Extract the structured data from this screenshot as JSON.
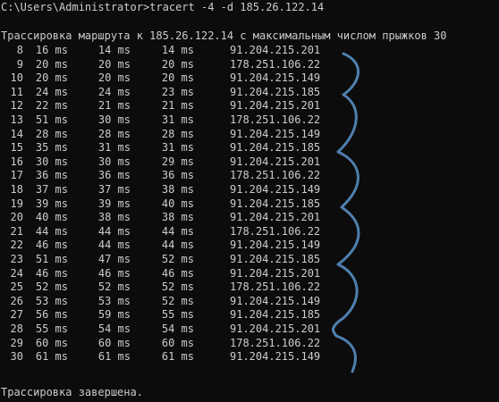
{
  "command_line": "C:\\Users\\Administrator>tracert -4 -d 185.26.122.14",
  "trace_header": "Трассировка маршрута к 185.26.122.14 с максимальным числом прыжков 30",
  "hops": [
    {
      "hop": "8",
      "r1": "16 ms",
      "r2": "14 ms",
      "r3": "14 ms",
      "ip": "91.204.215.201"
    },
    {
      "hop": "9",
      "r1": "20 ms",
      "r2": "20 ms",
      "r3": "20 ms",
      "ip": "178.251.106.22"
    },
    {
      "hop": "10",
      "r1": "20 ms",
      "r2": "20 ms",
      "r3": "20 ms",
      "ip": "91.204.215.149"
    },
    {
      "hop": "11",
      "r1": "24 ms",
      "r2": "24 ms",
      "r3": "23 ms",
      "ip": "91.204.215.185"
    },
    {
      "hop": "12",
      "r1": "22 ms",
      "r2": "21 ms",
      "r3": "21 ms",
      "ip": "91.204.215.201"
    },
    {
      "hop": "13",
      "r1": "51 ms",
      "r2": "30 ms",
      "r3": "31 ms",
      "ip": "178.251.106.22"
    },
    {
      "hop": "14",
      "r1": "28 ms",
      "r2": "28 ms",
      "r3": "28 ms",
      "ip": "91.204.215.149"
    },
    {
      "hop": "15",
      "r1": "35 ms",
      "r2": "31 ms",
      "r3": "31 ms",
      "ip": "91.204.215.185"
    },
    {
      "hop": "16",
      "r1": "30 ms",
      "r2": "30 ms",
      "r3": "29 ms",
      "ip": "91.204.215.201"
    },
    {
      "hop": "17",
      "r1": "36 ms",
      "r2": "36 ms",
      "r3": "36 ms",
      "ip": "178.251.106.22"
    },
    {
      "hop": "18",
      "r1": "37 ms",
      "r2": "37 ms",
      "r3": "38 ms",
      "ip": "91.204.215.149"
    },
    {
      "hop": "19",
      "r1": "39 ms",
      "r2": "39 ms",
      "r3": "40 ms",
      "ip": "91.204.215.185"
    },
    {
      "hop": "20",
      "r1": "40 ms",
      "r2": "38 ms",
      "r3": "38 ms",
      "ip": "91.204.215.201"
    },
    {
      "hop": "21",
      "r1": "44 ms",
      "r2": "44 ms",
      "r3": "44 ms",
      "ip": "178.251.106.22"
    },
    {
      "hop": "22",
      "r1": "46 ms",
      "r2": "44 ms",
      "r3": "44 ms",
      "ip": "91.204.215.149"
    },
    {
      "hop": "23",
      "r1": "51 ms",
      "r2": "47 ms",
      "r3": "52 ms",
      "ip": "91.204.215.185"
    },
    {
      "hop": "24",
      "r1": "46 ms",
      "r2": "46 ms",
      "r3": "46 ms",
      "ip": "91.204.215.201"
    },
    {
      "hop": "25",
      "r1": "52 ms",
      "r2": "52 ms",
      "r3": "52 ms",
      "ip": "178.251.106.22"
    },
    {
      "hop": "26",
      "r1": "53 ms",
      "r2": "53 ms",
      "r3": "52 ms",
      "ip": "91.204.215.149"
    },
    {
      "hop": "27",
      "r1": "56 ms",
      "r2": "59 ms",
      "r3": "55 ms",
      "ip": "91.204.215.185"
    },
    {
      "hop": "28",
      "r1": "55 ms",
      "r2": "54 ms",
      "r3": "54 ms",
      "ip": "91.204.215.201"
    },
    {
      "hop": "29",
      "r1": "60 ms",
      "r2": "60 ms",
      "r3": "60 ms",
      "ip": "178.251.106.22"
    },
    {
      "hop": "30",
      "r1": "61 ms",
      "r2": "61 ms",
      "r3": "61 ms",
      "ip": "91.204.215.149"
    }
  ],
  "trace_footer": "Трассировка завершена.",
  "colors": {
    "background": "#0c0c0c",
    "text": "#cccccc",
    "annotation": "#4f7fae"
  }
}
